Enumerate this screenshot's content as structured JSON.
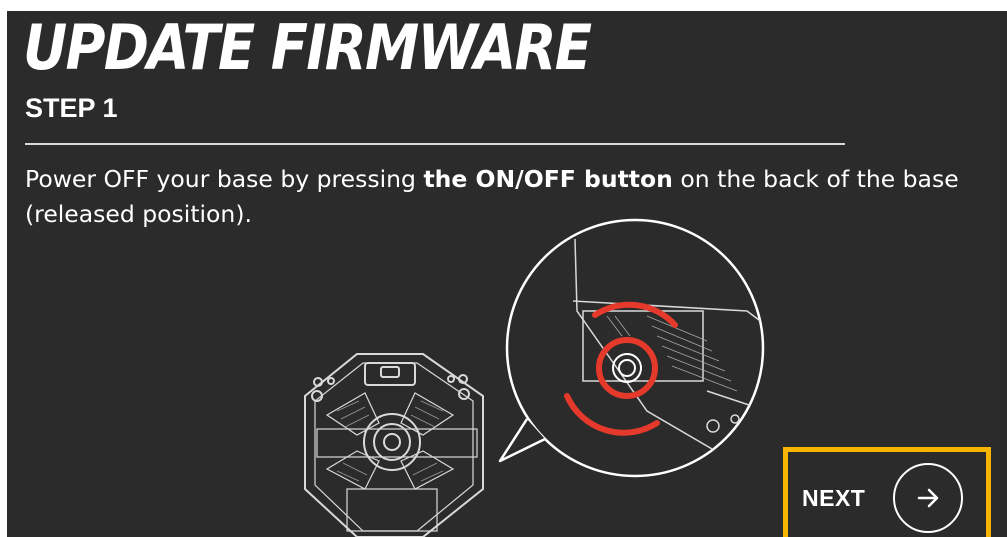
{
  "header": {
    "title": "UPDATE FIRMWARE",
    "step": "STEP 1"
  },
  "instruction": {
    "before": "Power OFF your base by pressing ",
    "bold": "the ON/OFF button",
    "after": " on the back of the base (released position)."
  },
  "navigation": {
    "next_label": "NEXT",
    "next_icon": "arrow-right-icon"
  },
  "colors": {
    "background": "#2b2b2b",
    "text": "#ffffff",
    "highlight": "#f7b500",
    "indicator": "#e53a2b"
  }
}
